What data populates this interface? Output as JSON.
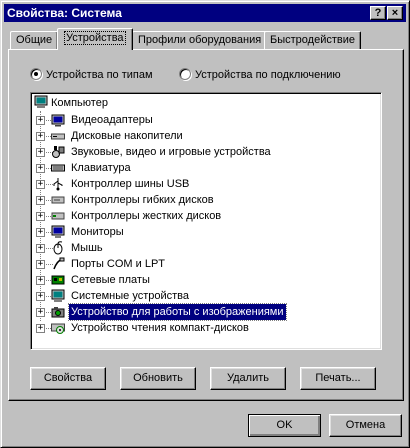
{
  "window": {
    "title": "Свойства: Система"
  },
  "titlebar": {
    "help_label": "?",
    "close_label": "×"
  },
  "tabs": [
    {
      "label": "Общие"
    },
    {
      "label": "Устройства"
    },
    {
      "label": "Профили оборудования"
    },
    {
      "label": "Быстродействие"
    }
  ],
  "view_mode": {
    "by_type": "Устройства по типам",
    "by_connection": "Устройства по подключению",
    "selected": "by_type"
  },
  "tree": {
    "root": "Компьютер",
    "items": [
      {
        "label": "Видеоадаптеры",
        "icon": "display-adapter-icon"
      },
      {
        "label": "Дисковые накопители",
        "icon": "disk-drive-icon"
      },
      {
        "label": "Звуковые, видео и игровые устройства",
        "icon": "sound-video-game-icon"
      },
      {
        "label": "Клавиатура",
        "icon": "keyboard-icon"
      },
      {
        "label": "Контроллер шины USB",
        "icon": "usb-icon"
      },
      {
        "label": "Контроллеры гибких дисков",
        "icon": "floppy-controller-icon"
      },
      {
        "label": "Контроллеры жестких дисков",
        "icon": "hard-disk-controller-icon"
      },
      {
        "label": "Мониторы",
        "icon": "monitor-icon"
      },
      {
        "label": "Мышь",
        "icon": "mouse-icon"
      },
      {
        "label": "Порты COM и LPT",
        "icon": "port-icon"
      },
      {
        "label": "Сетевые платы",
        "icon": "network-card-icon"
      },
      {
        "label": "Системные устройства",
        "icon": "system-devices-icon"
      },
      {
        "label": "Устройство для работы с изображениями",
        "icon": "imaging-device-icon",
        "selected": true
      },
      {
        "label": "Устройство чтения компакт-дисков",
        "icon": "cdrom-icon"
      }
    ]
  },
  "actions": {
    "properties": "Свойства",
    "refresh": "Обновить",
    "remove": "Удалить",
    "print": "Печать..."
  },
  "dialog": {
    "ok": "OK",
    "cancel": "Отмена"
  }
}
